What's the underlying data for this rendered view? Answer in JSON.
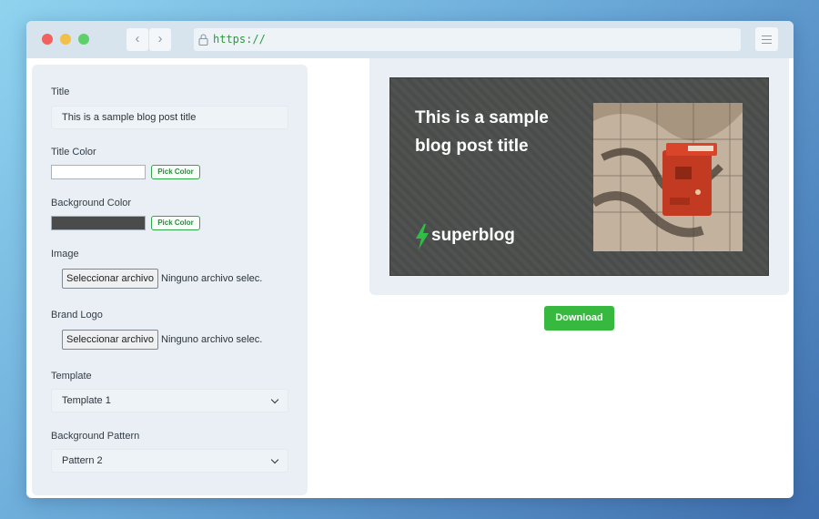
{
  "browser": {
    "url": "https://",
    "back_glyph": "‹",
    "forward_glyph": "›"
  },
  "form": {
    "title": {
      "label": "Title",
      "value": "This is a sample blog post title"
    },
    "title_color": {
      "label": "Title Color",
      "color": "#ffffff",
      "button": "Pick Color"
    },
    "background_color": {
      "label": "Background Color",
      "color": "#4a4c4b",
      "button": "Pick Color"
    },
    "image": {
      "label": "Image",
      "button": "Seleccionar archivo",
      "status": "Ninguno archivo selec."
    },
    "brand_logo": {
      "label": "Brand Logo",
      "button": "Seleccionar archivo",
      "status": "Ninguno archivo selec."
    },
    "template": {
      "label": "Template",
      "selected": "Template 1"
    },
    "background_pattern": {
      "label": "Background Pattern",
      "selected": "Pattern 2"
    }
  },
  "preview": {
    "title": "This is a sample blog post title",
    "brand_name": "superblog",
    "brand_color": "#2fbf45"
  },
  "actions": {
    "download": "Download"
  },
  "colors": {
    "accent": "#37b93f",
    "panel": "#e9eff4"
  }
}
